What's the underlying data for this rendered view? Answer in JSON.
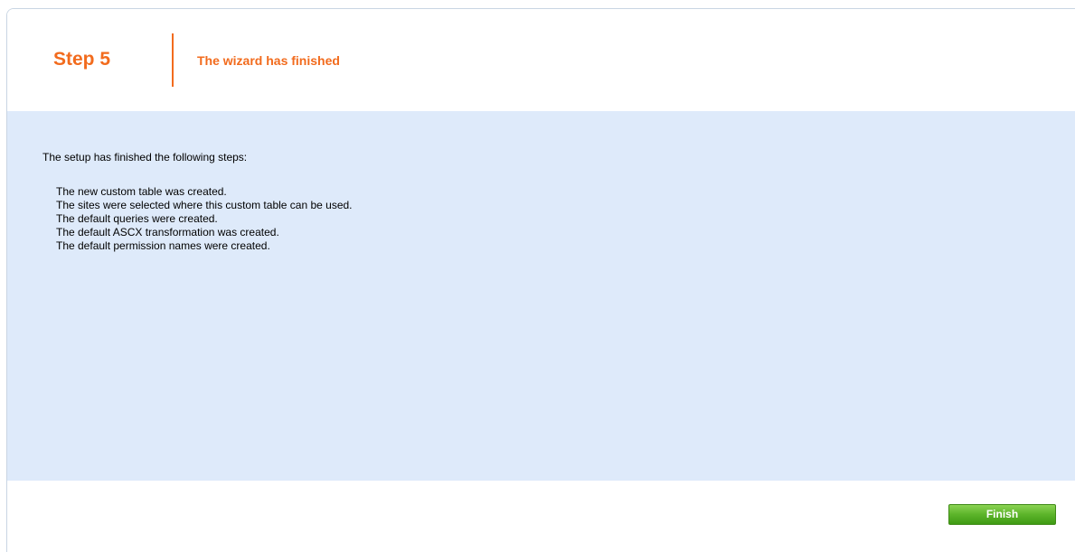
{
  "header": {
    "step_label": "Step 5",
    "step_title": "The wizard has finished"
  },
  "content": {
    "intro": "The setup has finished the following steps:",
    "steps": [
      "The new custom table was created.",
      "The sites were selected where this custom table can be used.",
      "The default queries were created.",
      "The default ASCX transformation was created.",
      "The default permission names were created."
    ]
  },
  "footer": {
    "finish_label": "Finish"
  },
  "colors": {
    "accent": "#f26b1d",
    "content_bg": "#deeafa",
    "button_green": "#5cb42a"
  }
}
